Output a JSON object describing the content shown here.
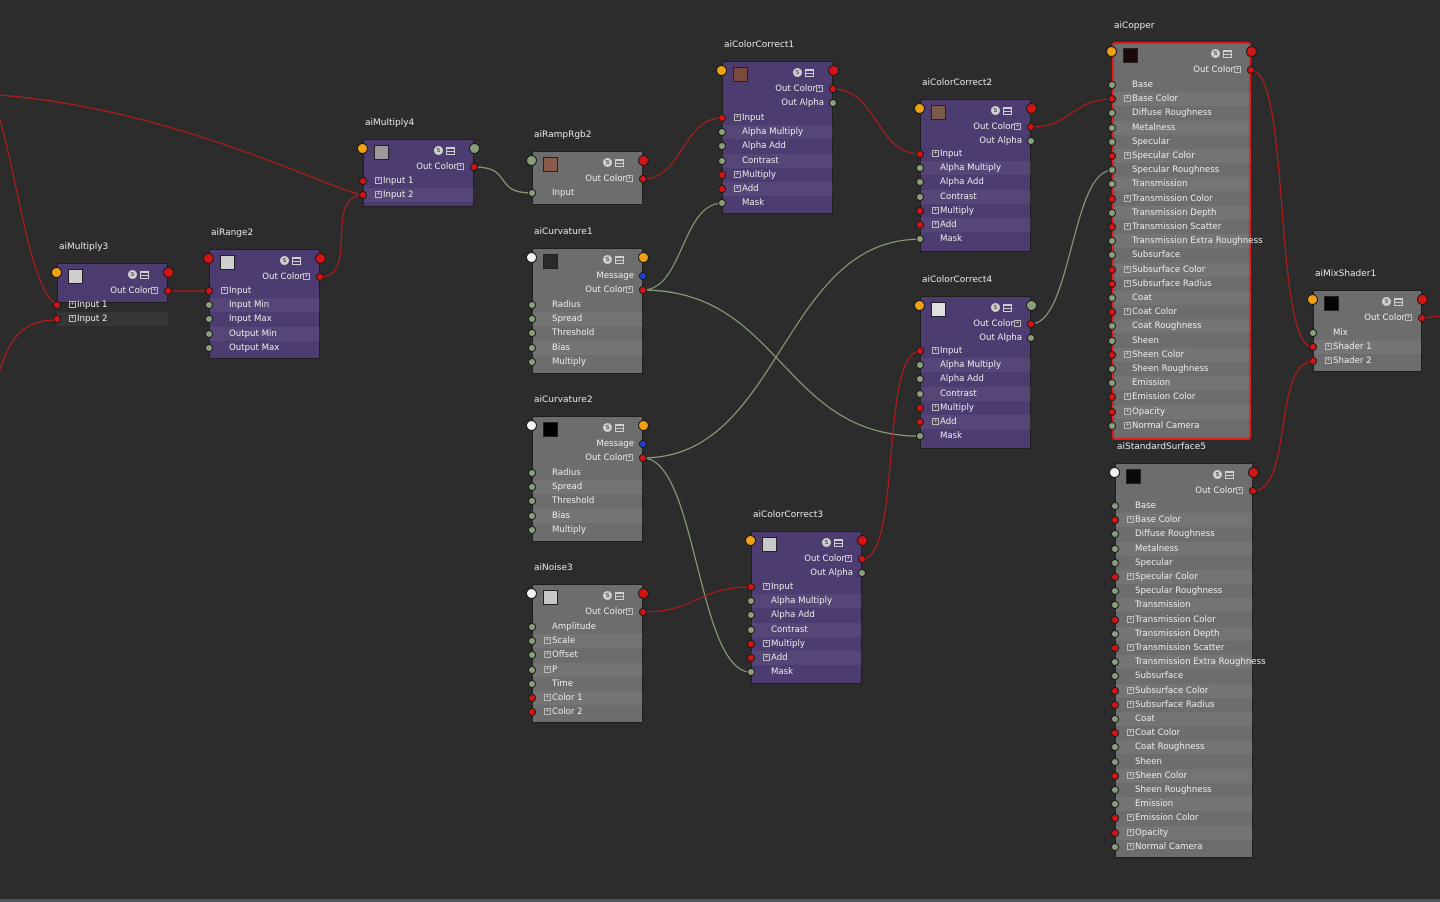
{
  "colors": {
    "background": "#2c2c2c",
    "node_purple": "#4d3c70",
    "node_gray": "#6d6d6d",
    "wire_red": "#b31c1c",
    "wire_green": "#8aa07a",
    "port_red": "#d31414",
    "port_green": "#8a9e7a",
    "port_yellow": "#f0a010",
    "port_white": "#f2f2f2",
    "port_blue": "#1f3fd8",
    "selected_border": "#e01c1c"
  },
  "nodes": {
    "aiMultiply3": {
      "title": "aiMultiply3",
      "swatch": "#cfcfcf",
      "head_port": "yellow",
      "outputs": [
        "Out Color"
      ],
      "inputs": [
        {
          "label": "Input 1",
          "plus": true,
          "port": "red"
        },
        {
          "label": "Input 2",
          "plus": true,
          "port": "red"
        }
      ]
    },
    "aiRange2": {
      "title": "aiRange2",
      "swatch": "#cfcfcf",
      "head_port": "red",
      "outputs": [
        "Out Color"
      ],
      "inputs": [
        {
          "label": "Input",
          "plus": true,
          "port": "red"
        },
        {
          "label": "Input Min",
          "plus": false,
          "port": "green"
        },
        {
          "label": "Input Max",
          "plus": false,
          "port": "green"
        },
        {
          "label": "Output Min",
          "plus": false,
          "port": "green"
        },
        {
          "label": "Output Max",
          "plus": false,
          "port": "green"
        }
      ]
    },
    "aiMultiply4": {
      "title": "aiMultiply4",
      "swatch": "#9a9a9a",
      "head_port": "yellow",
      "outputs": [
        "Out Color"
      ],
      "inputs": [
        {
          "label": "Input 1",
          "plus": true,
          "port": "red"
        },
        {
          "label": "Input 2",
          "plus": true,
          "port": "red"
        }
      ]
    },
    "aiRampRgb2": {
      "title": "aiRampRgb2",
      "swatch": "#8a5a4a",
      "head_port": "green",
      "outputs": [
        "Out Color"
      ],
      "inputs": [
        {
          "label": "Input",
          "plus": false,
          "port": "green"
        }
      ]
    },
    "aiColorCorrect1": {
      "title": "aiColorCorrect1",
      "swatch": "#7a4a3a",
      "head_port": "yellow",
      "outputs": [
        "Out Color",
        "Out Alpha"
      ],
      "inputs": [
        {
          "label": "Input",
          "plus": true,
          "port": "red"
        },
        {
          "label": "Alpha Multiply",
          "plus": false,
          "port": "green"
        },
        {
          "label": "Alpha Add",
          "plus": false,
          "port": "green"
        },
        {
          "label": "Contrast",
          "plus": false,
          "port": "green"
        },
        {
          "label": "Multiply",
          "plus": true,
          "port": "red"
        },
        {
          "label": "Add",
          "plus": true,
          "port": "red"
        },
        {
          "label": "Mask",
          "plus": false,
          "port": "green"
        }
      ]
    },
    "aiCurvature1": {
      "title": "aiCurvature1",
      "swatch": "#2a2a2a",
      "head_port": "white",
      "outputs": [
        "Message",
        "Out Color"
      ],
      "inputs": [
        {
          "label": "Radius",
          "plus": false,
          "port": "green"
        },
        {
          "label": "Spread",
          "plus": false,
          "port": "green"
        },
        {
          "label": "Threshold",
          "plus": false,
          "port": "green"
        },
        {
          "label": "Bias",
          "plus": false,
          "port": "green"
        },
        {
          "label": "Multiply",
          "plus": false,
          "port": "green"
        }
      ]
    },
    "aiCurvature2": {
      "title": "aiCurvature2",
      "swatch": "#000000",
      "head_port": "white",
      "outputs": [
        "Message",
        "Out Color"
      ],
      "inputs": [
        {
          "label": "Radius",
          "plus": false,
          "port": "green"
        },
        {
          "label": "Spread",
          "plus": false,
          "port": "green"
        },
        {
          "label": "Threshold",
          "plus": false,
          "port": "green"
        },
        {
          "label": "Bias",
          "plus": false,
          "port": "green"
        },
        {
          "label": "Multiply",
          "plus": false,
          "port": "green"
        }
      ]
    },
    "aiNoise3": {
      "title": "aiNoise3",
      "swatch": "#c8c8c8",
      "head_port": "white",
      "outputs": [
        "Out Color"
      ],
      "inputs": [
        {
          "label": "Amplitude",
          "plus": false,
          "port": "green"
        },
        {
          "label": "Scale",
          "plus": true,
          "port": "green"
        },
        {
          "label": "Offset",
          "plus": true,
          "port": "green"
        },
        {
          "label": "P",
          "plus": true,
          "port": "green"
        },
        {
          "label": "Time",
          "plus": false,
          "port": "green"
        },
        {
          "label": "Color 1",
          "plus": true,
          "port": "red"
        },
        {
          "label": "Color 2",
          "plus": true,
          "port": "red"
        }
      ]
    },
    "aiColorCorrect2": {
      "title": "aiColorCorrect2",
      "swatch": "#7a5a4a",
      "head_port": "yellow",
      "outputs": [
        "Out Color",
        "Out Alpha"
      ],
      "inputs": [
        {
          "label": "Input",
          "plus": true,
          "port": "red"
        },
        {
          "label": "Alpha Multiply",
          "plus": false,
          "port": "green"
        },
        {
          "label": "Alpha Add",
          "plus": false,
          "port": "green"
        },
        {
          "label": "Contrast",
          "plus": false,
          "port": "green"
        },
        {
          "label": "Multiply",
          "plus": true,
          "port": "red"
        },
        {
          "label": "Add",
          "plus": true,
          "port": "red"
        },
        {
          "label": "Mask",
          "plus": false,
          "port": "green"
        }
      ]
    },
    "aiColorCorrect4": {
      "title": "aiColorCorrect4",
      "swatch": "#e0e0e0",
      "head_port": "yellow",
      "outputs": [
        "Out Color",
        "Out Alpha"
      ],
      "inputs": [
        {
          "label": "Input",
          "plus": true,
          "port": "red"
        },
        {
          "label": "Alpha Multiply",
          "plus": false,
          "port": "green"
        },
        {
          "label": "Alpha Add",
          "plus": false,
          "port": "green"
        },
        {
          "label": "Contrast",
          "plus": false,
          "port": "green"
        },
        {
          "label": "Multiply",
          "plus": true,
          "port": "red"
        },
        {
          "label": "Add",
          "plus": true,
          "port": "red"
        },
        {
          "label": "Mask",
          "plus": false,
          "port": "green"
        }
      ]
    },
    "aiColorCorrect3": {
      "title": "aiColorCorrect3",
      "swatch": "#c8c8c8",
      "head_port": "yellow",
      "outputs": [
        "Out Color",
        "Out Alpha"
      ],
      "inputs": [
        {
          "label": "Input",
          "plus": true,
          "port": "red"
        },
        {
          "label": "Alpha Multiply",
          "plus": false,
          "port": "green"
        },
        {
          "label": "Alpha Add",
          "plus": false,
          "port": "green"
        },
        {
          "label": "Contrast",
          "plus": false,
          "port": "green"
        },
        {
          "label": "Multiply",
          "plus": true,
          "port": "red"
        },
        {
          "label": "Add",
          "plus": true,
          "port": "red"
        },
        {
          "label": "Mask",
          "plus": false,
          "port": "green"
        }
      ]
    },
    "aiCopper": {
      "title": "aiCopper",
      "swatch": "#1a0a0a",
      "head_port": "yellow",
      "selected": true,
      "outputs": [
        "Out Color"
      ],
      "inputs": [
        {
          "label": "Base",
          "plus": false,
          "port": "green"
        },
        {
          "label": "Base Color",
          "plus": true,
          "port": "red"
        },
        {
          "label": "Diffuse Roughness",
          "plus": false,
          "port": "green"
        },
        {
          "label": "Metalness",
          "plus": false,
          "port": "green"
        },
        {
          "label": "Specular",
          "plus": false,
          "port": "green"
        },
        {
          "label": "Specular Color",
          "plus": true,
          "port": "red"
        },
        {
          "label": "Specular Roughness",
          "plus": false,
          "port": "green"
        },
        {
          "label": "Transmission",
          "plus": false,
          "port": "green"
        },
        {
          "label": "Transmission Color",
          "plus": true,
          "port": "red"
        },
        {
          "label": "Transmission Depth",
          "plus": false,
          "port": "green"
        },
        {
          "label": "Transmission Scatter",
          "plus": true,
          "port": "red"
        },
        {
          "label": "Transmission Extra Roughness",
          "plus": false,
          "port": "green"
        },
        {
          "label": "Subsurface",
          "plus": false,
          "port": "green"
        },
        {
          "label": "Subsurface Color",
          "plus": true,
          "port": "red"
        },
        {
          "label": "Subsurface Radius",
          "plus": true,
          "port": "red"
        },
        {
          "label": "Coat",
          "plus": false,
          "port": "green"
        },
        {
          "label": "Coat Color",
          "plus": true,
          "port": "red"
        },
        {
          "label": "Coat Roughness",
          "plus": false,
          "port": "green"
        },
        {
          "label": "Sheen",
          "plus": false,
          "port": "green"
        },
        {
          "label": "Sheen Color",
          "plus": true,
          "port": "red"
        },
        {
          "label": "Sheen Roughness",
          "plus": false,
          "port": "green"
        },
        {
          "label": "Emission",
          "plus": false,
          "port": "green"
        },
        {
          "label": "Emission Color",
          "plus": true,
          "port": "red"
        },
        {
          "label": "Opacity",
          "plus": true,
          "port": "red"
        },
        {
          "label": "Normal Camera",
          "plus": true,
          "port": "green"
        }
      ]
    },
    "aiStandardSurface5": {
      "title": "aiStandardSurface5",
      "swatch": "#0a0a0a",
      "head_port": "white",
      "outputs": [
        "Out Color"
      ],
      "inputs": [
        {
          "label": "Base",
          "plus": false,
          "port": "green"
        },
        {
          "label": "Base Color",
          "plus": true,
          "port": "red"
        },
        {
          "label": "Diffuse Roughness",
          "plus": false,
          "port": "green"
        },
        {
          "label": "Metalness",
          "plus": false,
          "port": "green"
        },
        {
          "label": "Specular",
          "plus": false,
          "port": "green"
        },
        {
          "label": "Specular Color",
          "plus": true,
          "port": "red"
        },
        {
          "label": "Specular Roughness",
          "plus": false,
          "port": "green"
        },
        {
          "label": "Transmission",
          "plus": false,
          "port": "green"
        },
        {
          "label": "Transmission Color",
          "plus": true,
          "port": "red"
        },
        {
          "label": "Transmission Depth",
          "plus": false,
          "port": "green"
        },
        {
          "label": "Transmission Scatter",
          "plus": true,
          "port": "red"
        },
        {
          "label": "Transmission Extra Roughness",
          "plus": false,
          "port": "green"
        },
        {
          "label": "Subsurface",
          "plus": false,
          "port": "green"
        },
        {
          "label": "Subsurface Color",
          "plus": true,
          "port": "red"
        },
        {
          "label": "Subsurface Radius",
          "plus": true,
          "port": "red"
        },
        {
          "label": "Coat",
          "plus": false,
          "port": "green"
        },
        {
          "label": "Coat Color",
          "plus": true,
          "port": "red"
        },
        {
          "label": "Coat Roughness",
          "plus": false,
          "port": "green"
        },
        {
          "label": "Sheen",
          "plus": false,
          "port": "green"
        },
        {
          "label": "Sheen Color",
          "plus": true,
          "port": "red"
        },
        {
          "label": "Sheen Roughness",
          "plus": false,
          "port": "green"
        },
        {
          "label": "Emission",
          "plus": false,
          "port": "green"
        },
        {
          "label": "Emission Color",
          "plus": true,
          "port": "red"
        },
        {
          "label": "Opacity",
          "plus": true,
          "port": "red"
        },
        {
          "label": "Normal Camera",
          "plus": true,
          "port": "green"
        }
      ]
    },
    "aiMixShader1": {
      "title": "aiMixShader1",
      "swatch": "#050505",
      "head_port": "yellow",
      "outputs": [
        "Out Color"
      ],
      "inputs": [
        {
          "label": "Mix",
          "plus": false,
          "port": "green"
        },
        {
          "label": "Shader 1",
          "plus": true,
          "port": "red"
        },
        {
          "label": "Shader 2",
          "plus": true,
          "port": "red"
        }
      ]
    }
  },
  "connections": [
    {
      "from": "aiMultiply3.Out Color",
      "to": "aiRange2.Input",
      "color": "red"
    },
    {
      "from": "aiRange2.Out Color",
      "to": "aiMultiply4.Input 2",
      "color": "red"
    },
    {
      "from": "aiMultiply4.Out Color",
      "to": "aiRampRgb2.Input",
      "color": "green"
    },
    {
      "from": "aiRampRgb2.Out Color",
      "to": "aiColorCorrect1.Input",
      "color": "red"
    },
    {
      "from": "aiColorCorrect1.Out Color",
      "to": "aiColorCorrect2.Input",
      "color": "red"
    },
    {
      "from": "aiCurvature1.Out Color",
      "to": "aiColorCorrect1.Mask",
      "color": "green"
    },
    {
      "from": "aiCurvature1.Out Color",
      "to": "aiColorCorrect4.Mask",
      "color": "green"
    },
    {
      "from": "aiCurvature2.Out Color",
      "to": "aiColorCorrect2.Mask",
      "color": "green"
    },
    {
      "from": "aiCurvature2.Out Color",
      "to": "aiColorCorrect3.Mask",
      "color": "green"
    },
    {
      "from": "aiNoise3.Out Color",
      "to": "aiColorCorrect3.Input",
      "color": "red"
    },
    {
      "from": "aiColorCorrect3.Out Color",
      "to": "aiColorCorrect4.Input",
      "color": "red"
    },
    {
      "from": "aiColorCorrect2.Out Color",
      "to": "aiCopper.Base Color",
      "color": "red"
    },
    {
      "from": "aiColorCorrect4.Out Color",
      "to": "aiCopper.Specular Roughness",
      "color": "green"
    },
    {
      "from": "aiCopper.Out Color",
      "to": "aiMixShader1.Shader 1",
      "color": "red"
    },
    {
      "from": "aiStandardSurface5.Out Color",
      "to": "aiMixShader1.Shader 2",
      "color": "red"
    }
  ]
}
